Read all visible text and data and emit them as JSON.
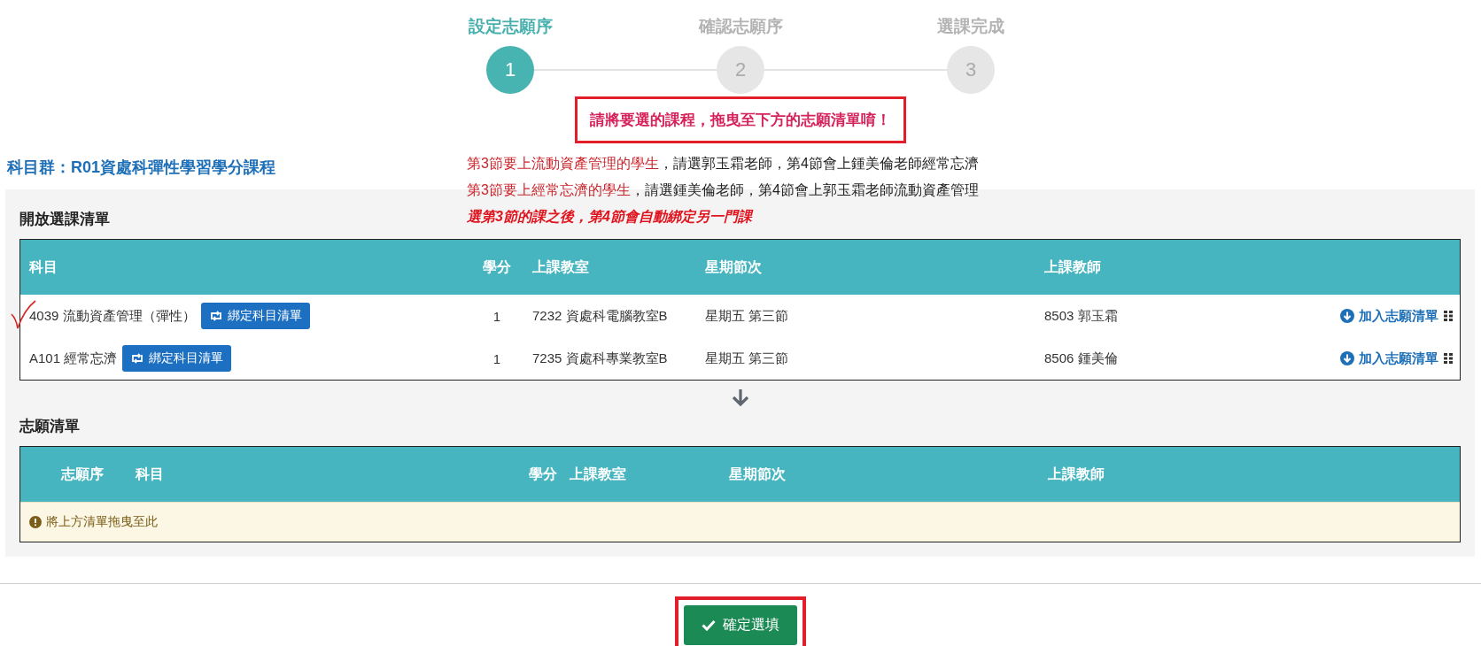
{
  "steps": [
    {
      "label": "設定志願序",
      "number": "1",
      "selected": true
    },
    {
      "label": "確認志願序",
      "number": "2",
      "selected": false
    },
    {
      "label": "選課完成",
      "number": "3",
      "selected": false
    }
  ],
  "notice": "請將要選的課程，拖曳至下方的志願清單唷！",
  "subject_group": "科目群：R01資處科彈性學習學分課程",
  "instructions": [
    {
      "highlight": "第3節要上流動資產管理的學生",
      "text": "，請選郭玉霜老師，第4節會上鍾美倫老師經常忘濟"
    },
    {
      "highlight": "第3節要上經常忘濟的學生",
      "text": "，請選鍾美倫老師，第4節會上郭玉霜老師流動資產管理"
    }
  ],
  "bind_note": "選第3節的課之後，第4節會自動綁定另一門課",
  "open_list": {
    "title": "開放選課清單",
    "columns": [
      "科目",
      "學分",
      "上課教室",
      "星期節次",
      "上課教師"
    ],
    "rows": [
      {
        "subject": "4039 流動資產管理（彈性）",
        "bind_button": "綁定科目清單",
        "credits": "1",
        "room": "7232 資處科電腦教室B",
        "time": "星期五 第三節",
        "teacher": "8503 郭玉霜",
        "action": "加入志願清單",
        "marked": true
      },
      {
        "subject": "A101 經常忘濟",
        "bind_button": "綁定科目清單",
        "credits": "1",
        "room": "7235 資處科專業教室B",
        "time": "星期五 第三節",
        "teacher": "8506 鍾美倫",
        "action": "加入志願清單",
        "marked": false
      }
    ]
  },
  "wish_list": {
    "title": "志願清單",
    "columns": [
      "志願序",
      "科目",
      "學分",
      "上課教室",
      "星期節次",
      "上課教師"
    ],
    "empty_message": "將上方清單拖曳至此"
  },
  "confirm_button": "確定選填"
}
